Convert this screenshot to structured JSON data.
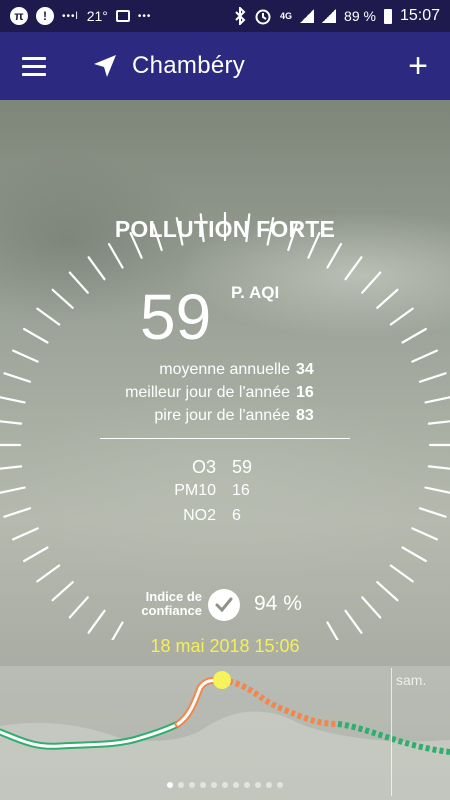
{
  "status_bar": {
    "pi_badge": "π",
    "alert_badge": "!",
    "carrier_dots": "•••l",
    "temperature": "21°",
    "more_dots": "•••",
    "network": "4G",
    "battery": "89 %",
    "time": "15:07"
  },
  "app_bar": {
    "city": "Chambéry",
    "add_label": "+"
  },
  "pollution": {
    "headline": "POLLUTION FORTE",
    "aqi_value": "59",
    "aqi_unit": "P. AQI",
    "stats": [
      {
        "label": "moyenne annuelle",
        "value": "34"
      },
      {
        "label": "meilleur jour de l'année",
        "value": "16"
      },
      {
        "label": "pire jour de l'année",
        "value": "83"
      }
    ],
    "pollutants": [
      {
        "name": "O3",
        "value": "59"
      },
      {
        "name": "PM10",
        "value": "16"
      },
      {
        "name": "NO2",
        "value": "6"
      }
    ]
  },
  "confidence": {
    "label": "Indice de confiance",
    "value": "94 %"
  },
  "date": "18 mai 2018 15:06",
  "forecast": {
    "day_label": "sam.",
    "colors": {
      "good": "#2fae6e",
      "moderate": "#ffffff",
      "high": "#f0874f",
      "cursor": "#f7f35a"
    }
  },
  "pager": {
    "count": 11,
    "active": 0
  }
}
